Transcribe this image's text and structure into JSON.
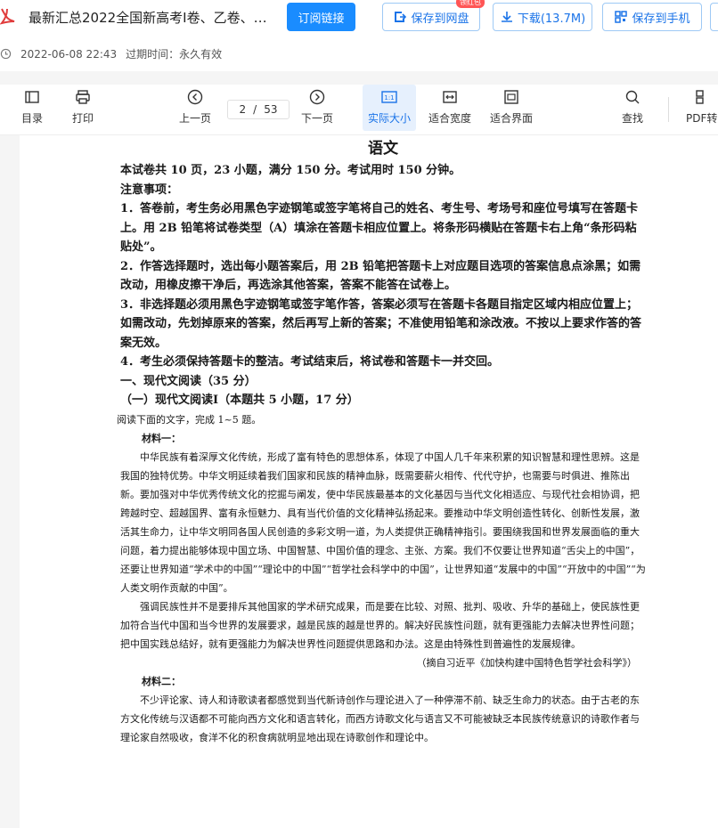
{
  "header": {
    "title": "最新汇总2022全国新高考Ⅰ卷、乙卷、…",
    "subscribe_label": "订阅链接",
    "save_disk_label": "保存到网盘",
    "download_label": "下载(13.7M)",
    "save_phone_label": "保存到手机",
    "redbag_label": "领红包",
    "date": "2022-06-08 22:43",
    "expire": "过期时间：永久有效"
  },
  "toolbar": {
    "toc": "目录",
    "print": "打印",
    "prev": "上一页",
    "page_current": "2",
    "page_sep": "/",
    "page_total": "53",
    "next": "下一页",
    "actual": "实际大小",
    "fit_width": "适合宽度",
    "fit_page": "适合界面",
    "search": "查找",
    "pdf_convert": "PDF转",
    "accent": "#1a73e8"
  },
  "doc": {
    "title": "语文",
    "intro": "本试卷共 10 页，23 小题，满分 150 分。考试用时 150 分钟。",
    "notice": "注意事项：",
    "n1": "1．答卷前，考生务必用黑色字迹钢笔或签字笔将自己的姓名、考生号、考场号和座位号填写在答题卡上。用 2B 铅笔将试卷类型（A）填涂在答题卡相应位置上。将条形码横贴在答题卡右上角“条形码粘贴处”。",
    "n2": "2．作答选择题时，选出每小题答案后，用 2B 铅笔把答题卡上对应题目选项的答案信息点涂黑；如需改动，用橡皮擦干净后，再选涂其他答案，答案不能答在试卷上。",
    "n3": "3．非选择题必须用黑色字迹钢笔或签字笔作答，答案必须写在答题卡各题目指定区域内相应位置上；如需改动，先划掉原来的答案，然后再写上新的答案；不准使用铅笔和涂改液。不按以上要求作答的答案无效。",
    "n4": "4．考生必须保持答题卡的整洁。考试结束后，将试卷和答题卡一并交回。",
    "s1": "一、现代文阅读（35 分）",
    "s2": "（一）现代文阅读Ⅰ（本题共 5 小题，17 分）",
    "s3": "阅读下面的文字，完成 1~5 题。",
    "m1_label": "材料一：",
    "m1_p1": "中华民族有着深厚文化传统，形成了富有特色的思想体系，体现了中国人几千年来积累的知识智慧和理性思辨。这是我国的独特优势。中华文明延续着我们国家和民族的精神血脉，既需要薪火相传、代代守护，也需要与时俱进、推陈出新。要加强对中华优秀传统文化的挖掘与阐发，使中华民族最基本的文化基因与当代文化相适应、与现代社会相协调，把跨越时空、超越国界、富有永恒魅力、具有当代价值的文化精神弘扬起来。要推动中华文明创造性转化、创新性发展，激活其生命力，让中华文明同各国人民创造的多彩文明一道，为人类提供正确精神指引。要围绕我国和世界发展面临的重大问题，着力提出能够体现中国立场、中国智慧、中国价值的理念、主张、方案。我们不仅要让世界知道“舌尖上的中国”，还要让世界知道“学术中的中国”“理论中的中国”“哲学社会科学中的中国”，让世界知道“发展中的中国”“开放中的中国”“为人类文明作贡献的中国”。",
    "m1_p2": "强调民族性并不是要排斥其他国家的学术研究成果，而是要在比较、对照、批判、吸收、升华的基础上，使民族性更加符合当代中国和当今世界的发展要求，越是民族的越是世界的。解决好民族性问题，就有更强能力去解决世界性问题；把中国实践总结好，就有更强能力为解决世界性问题提供思路和办法。这是由特殊性到普遍性的发展规律。",
    "m1_src": "（摘自习近平《加快构建中国特色哲学社会科学》）",
    "m2_label": "材料二：",
    "m2_p1": "不少评论家、诗人和诗歌读者都感觉到当代新诗创作与理论进入了一种停滞不前、缺乏生命力的状态。由于古老的东方文化传统与汉语都不可能向西方文化和语言转化，而西方诗歌文化与语言又不可能被缺乏本民族传统意识的诗歌作者与理论家自然吸收，食洋不化的积食病就明显地出现在诗歌创作和理论中。"
  }
}
